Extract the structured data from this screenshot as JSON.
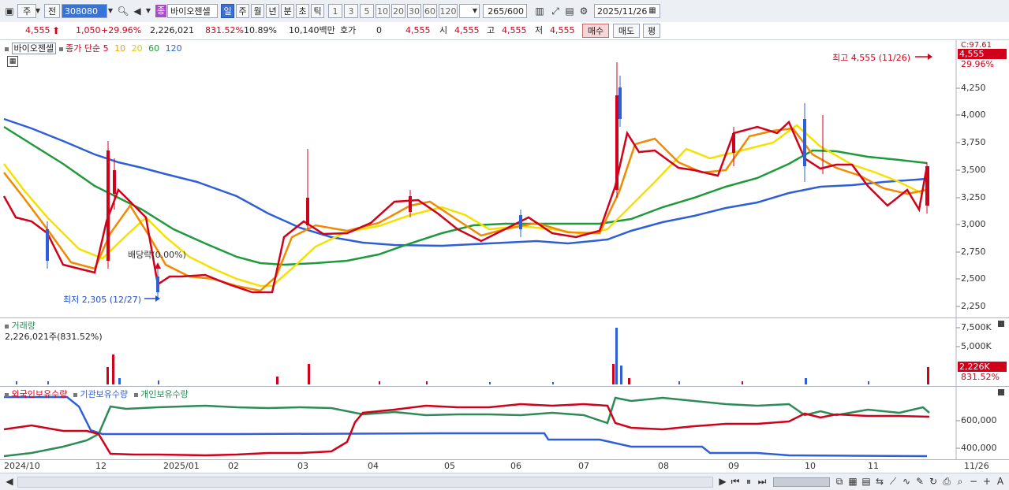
{
  "toolbar": {
    "market": "주",
    "prev_label": "전",
    "code": "308080",
    "stock_name": "바이오젠셀",
    "stock_badge": "종",
    "periods": [
      "일",
      "주",
      "월",
      "년",
      "분",
      "초",
      "틱"
    ],
    "active_period": "일",
    "minute_steps": [
      "1",
      "3",
      "5",
      "10",
      "20",
      "30",
      "60",
      "120"
    ],
    "count": "265",
    "count_total": "/600",
    "date": "2025/11/26"
  },
  "info": {
    "price": "4,555",
    "change": "1,050",
    "change_pct": "+29.96%",
    "volume": "2,226,021",
    "volume_ratio": "831.52%",
    "turnover_rate": "10.89%",
    "amount": "10,140백만",
    "hoga_label": "호가",
    "hoga_value": "0",
    "hoga_price": "4,555",
    "open_label": "시",
    "open": "4,555",
    "high_label": "고",
    "high": "4,555",
    "low_label": "저",
    "low": "4,555",
    "buy_label": "매수",
    "sell_label": "매도",
    "avg_label": "평"
  },
  "price_panel": {
    "legend_name": "바이오젠셀",
    "legend_close": "종가 단순",
    "ma_periods": [
      "5",
      "10",
      "20",
      "60",
      "120"
    ],
    "ma_colors": [
      "#d0021b",
      "#f0a000",
      "#f5e100",
      "#1f9a3a",
      "#2f5fd8"
    ],
    "high_note": "최고 4,555 (11/26)",
    "low_note": "최저 2,305 (12/27)",
    "dividend_note": "배당락(0.00%)",
    "corner_label": "C:97.61",
    "price_tag": "4,555",
    "pct_tag": "29.96%",
    "y_ticks": [
      "4,250",
      "4,000",
      "3,750",
      "3,500",
      "3,250",
      "3,000",
      "2,750",
      "2,500",
      "2,250"
    ]
  },
  "volume_panel": {
    "title": "거래량",
    "summary": "2,226,021주(831.52%)",
    "y_ticks": [
      "7,500K",
      "5,000K"
    ],
    "value_tag": "2,226K",
    "pct_tag": "831.52%"
  },
  "holding_panel": {
    "legends": [
      "외국인보유수량",
      "기관보유수량",
      "개인보유수량"
    ],
    "legend_colors": [
      "#d0021b",
      "#2f5fd8",
      "#2e8b57"
    ],
    "y_ticks": [
      "600,000",
      "400,000"
    ]
  },
  "x_axis": [
    "2024/10",
    "12",
    "2025/01",
    "02",
    "03",
    "04",
    "05",
    "06",
    "07",
    "08",
    "09",
    "10",
    "11",
    "11/26"
  ]
}
